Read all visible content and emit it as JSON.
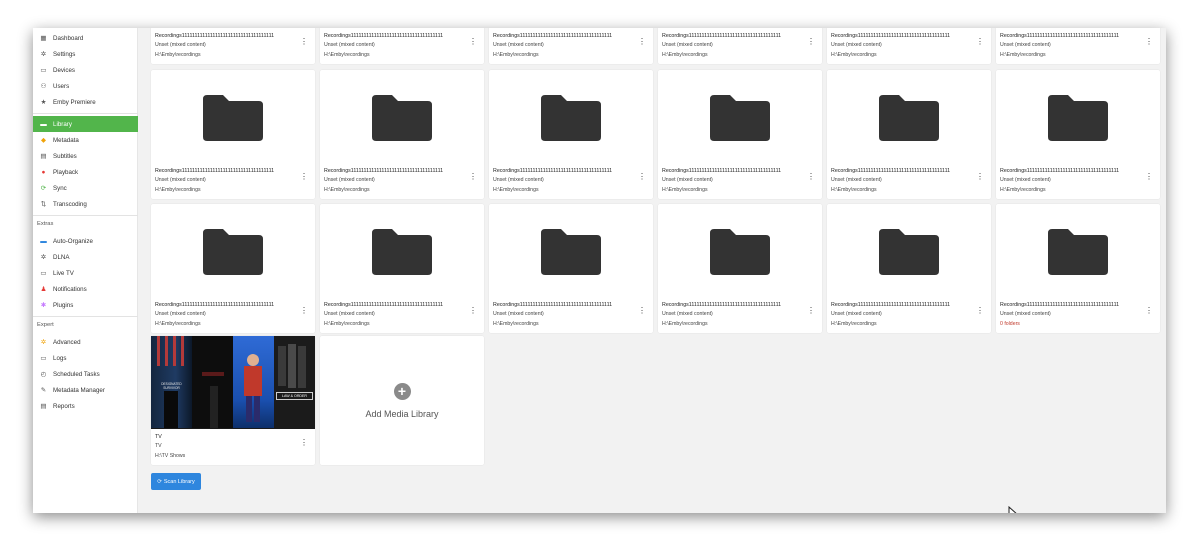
{
  "sidebar": {
    "items_top": [
      {
        "label": "Dashboard",
        "icon": "dashboard-icon",
        "glyph": "▦"
      },
      {
        "label": "Settings",
        "icon": "gear-icon",
        "glyph": "✲"
      },
      {
        "label": "Devices",
        "icon": "devices-icon",
        "glyph": "▭"
      },
      {
        "label": "Users",
        "icon": "users-icon",
        "glyph": "⚇"
      },
      {
        "label": "Emby Premiere",
        "icon": "star-icon",
        "glyph": "★"
      }
    ],
    "items_library": [
      {
        "label": "Library",
        "icon": "folder-icon",
        "glyph": "▬"
      },
      {
        "label": "Metadata",
        "icon": "metadata-icon",
        "glyph": "◆"
      },
      {
        "label": "Subtitles",
        "icon": "subtitles-icon",
        "glyph": "▤"
      },
      {
        "label": "Playback",
        "icon": "playback-icon",
        "glyph": "●"
      },
      {
        "label": "Sync",
        "icon": "sync-icon",
        "glyph": "⟳"
      },
      {
        "label": "Transcoding",
        "icon": "transcoding-icon",
        "glyph": "⇅"
      }
    ],
    "extras_header": "Extras",
    "items_extras": [
      {
        "label": "Auto-Organize",
        "icon": "auto-organize-icon",
        "glyph": "▬"
      },
      {
        "label": "DLNA",
        "icon": "dlna-icon",
        "glyph": "✲"
      },
      {
        "label": "Live TV",
        "icon": "live-tv-icon",
        "glyph": "▭"
      },
      {
        "label": "Notifications",
        "icon": "bell-icon",
        "glyph": "♟"
      },
      {
        "label": "Plugins",
        "icon": "plugins-icon",
        "glyph": "✱"
      }
    ],
    "expert_header": "Expert",
    "items_expert": [
      {
        "label": "Advanced",
        "icon": "advanced-icon",
        "glyph": "✲"
      },
      {
        "label": "Logs",
        "icon": "logs-icon",
        "glyph": "▭"
      },
      {
        "label": "Scheduled Tasks",
        "icon": "clock-icon",
        "glyph": "◴"
      },
      {
        "label": "Metadata Manager",
        "icon": "pencil-icon",
        "glyph": "✎"
      },
      {
        "label": "Reports",
        "icon": "reports-icon",
        "glyph": "▤"
      }
    ],
    "colors": {
      "active": "#52b54b",
      "metadata": "#f0a30a",
      "playback": "#e53935",
      "sync": "#52b54b",
      "autoorganize": "#2e86de",
      "notifications": "#e53935",
      "plugins": "#c77dff",
      "advanced": "#f0a30a"
    }
  },
  "library": {
    "recording_title": "Recordings111111111111111111111111111111111111",
    "recording_type": "Unset (mixed content)",
    "recording_path": "H:\\Emby\\recordings",
    "zero_folders": "0 folders",
    "tv_title": "TV",
    "tv_type": "TV",
    "tv_path": "H:\\TV Shows",
    "add_label": "Add Media Library",
    "poster_texts": {
      "designated": "DESIGNATED SURVIVOR",
      "lawandorder": "LAW & ORDER"
    }
  },
  "actions": {
    "scan_label": "Scan Library",
    "menu_glyph": "⋮"
  }
}
